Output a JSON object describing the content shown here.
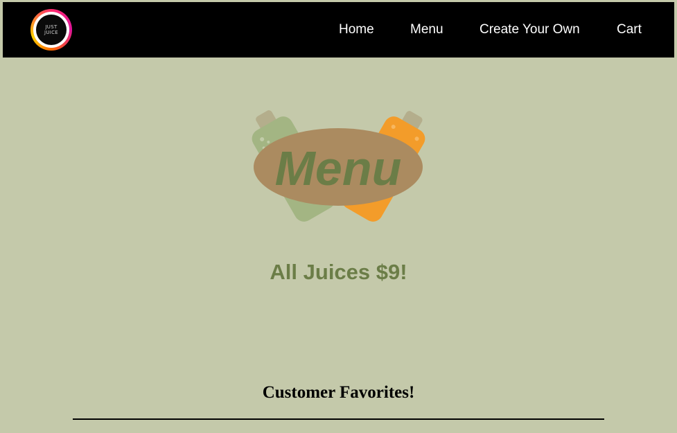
{
  "navbar": {
    "logo": {
      "line1": "JUST",
      "line2": "JUICE"
    },
    "links": {
      "home": "Home",
      "menu": "Menu",
      "create": "Create Your Own",
      "cart": "Cart"
    }
  },
  "hero": {
    "title": "Menu",
    "icons": [
      "green-juice-bottle-icon",
      "orange-juice-bottle-icon"
    ]
  },
  "pricing": {
    "headline": "All Juices $9!"
  },
  "favorites": {
    "title": "Customer Favorites!"
  },
  "colors": {
    "background": "#c4c9aa",
    "navbar": "#000000",
    "accent_green": "#6b7d47",
    "oval": "#ab8b60",
    "green_bottle": "#a3b583",
    "orange_bottle": "#f39c2a"
  }
}
